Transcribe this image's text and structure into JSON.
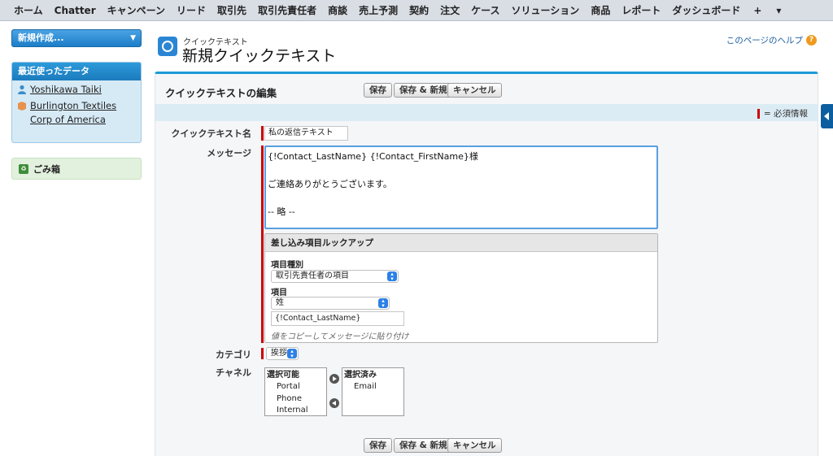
{
  "nav": {
    "tabs": [
      "ホーム",
      "Chatter",
      "キャンペーン",
      "リード",
      "取引先",
      "取引先責任者",
      "商談",
      "売上予測",
      "契約",
      "注文",
      "ケース",
      "ソリューション",
      "商品",
      "レポート",
      "ダッシュボード"
    ],
    "plus": "+",
    "more": "▾"
  },
  "sidebar": {
    "create_new": "新規作成...",
    "recent_title": "最近使ったデータ",
    "recent_items": [
      "Yoshikawa Taiki",
      "Burlington Textiles Corp of America"
    ],
    "trash": "ごみ箱"
  },
  "header": {
    "subtitle": "クイックテキスト",
    "title": "新規クイックテキスト",
    "help": "このページのヘルプ"
  },
  "panel": {
    "title": "クイックテキストの編集",
    "save": "保存",
    "save_new": "保存 & 新規",
    "cancel": "キャンセル",
    "required_legend": "= 必須情報"
  },
  "form": {
    "name_label": "クイックテキスト名",
    "name_value": "私の返信テキスト",
    "message_label": "メッセージ",
    "message_lines": [
      "{!Contact_LastName} {!Contact_FirstName}様",
      "",
      "ご連絡ありがとうございます。",
      "",
      "-- 略 --"
    ],
    "category_label": "カテゴリ",
    "category_value": "挨拶",
    "channel_label": "チャネル"
  },
  "lookup": {
    "title": "差し込み項目ルックアップ",
    "type_label": "項目種別",
    "type_value": "取引先責任者の項目",
    "field_label": "項目",
    "field_value": "姓",
    "merge_value": "{!Contact_LastName}",
    "hint": "値をコピーしてメッセージに貼り付け"
  },
  "channels": {
    "available_title": "選択可能",
    "available": [
      "Portal",
      "Phone",
      "Internal"
    ],
    "selected_title": "選択済み",
    "selected": [
      "Email"
    ]
  },
  "colors": {
    "accent": "#1b9ad6",
    "required": "#cc0000",
    "help_icon": "#ef9a1f"
  }
}
